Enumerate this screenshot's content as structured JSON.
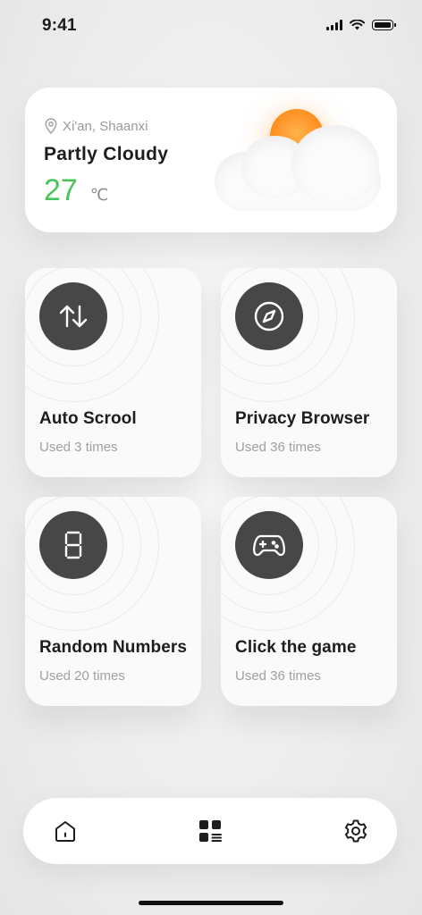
{
  "status_bar": {
    "time": "9:41"
  },
  "weather": {
    "location": "Xi'an, Shaanxi",
    "condition": "Partly Cloudy",
    "temperature": "27",
    "unit": "℃",
    "colors": {
      "temperature": "#4cc45c",
      "sun": "#ff8d1f"
    }
  },
  "features": [
    {
      "title": "Auto Scrool",
      "usage": "Used 3 times",
      "icon": "arrows-up-down-icon"
    },
    {
      "title": "Privacy Browser",
      "usage": "Used 36 times",
      "icon": "compass-icon"
    },
    {
      "title": "Random Numbers",
      "usage": "Used 20 times",
      "icon": "digital-eight-icon"
    },
    {
      "title": "Click the game",
      "usage": "Used 36 times",
      "icon": "gamepad-icon"
    }
  ],
  "tab_bar": {
    "tabs": [
      {
        "icon": "home-icon"
      },
      {
        "icon": "apps-grid-icon",
        "active": true
      },
      {
        "icon": "gear-icon"
      }
    ]
  }
}
